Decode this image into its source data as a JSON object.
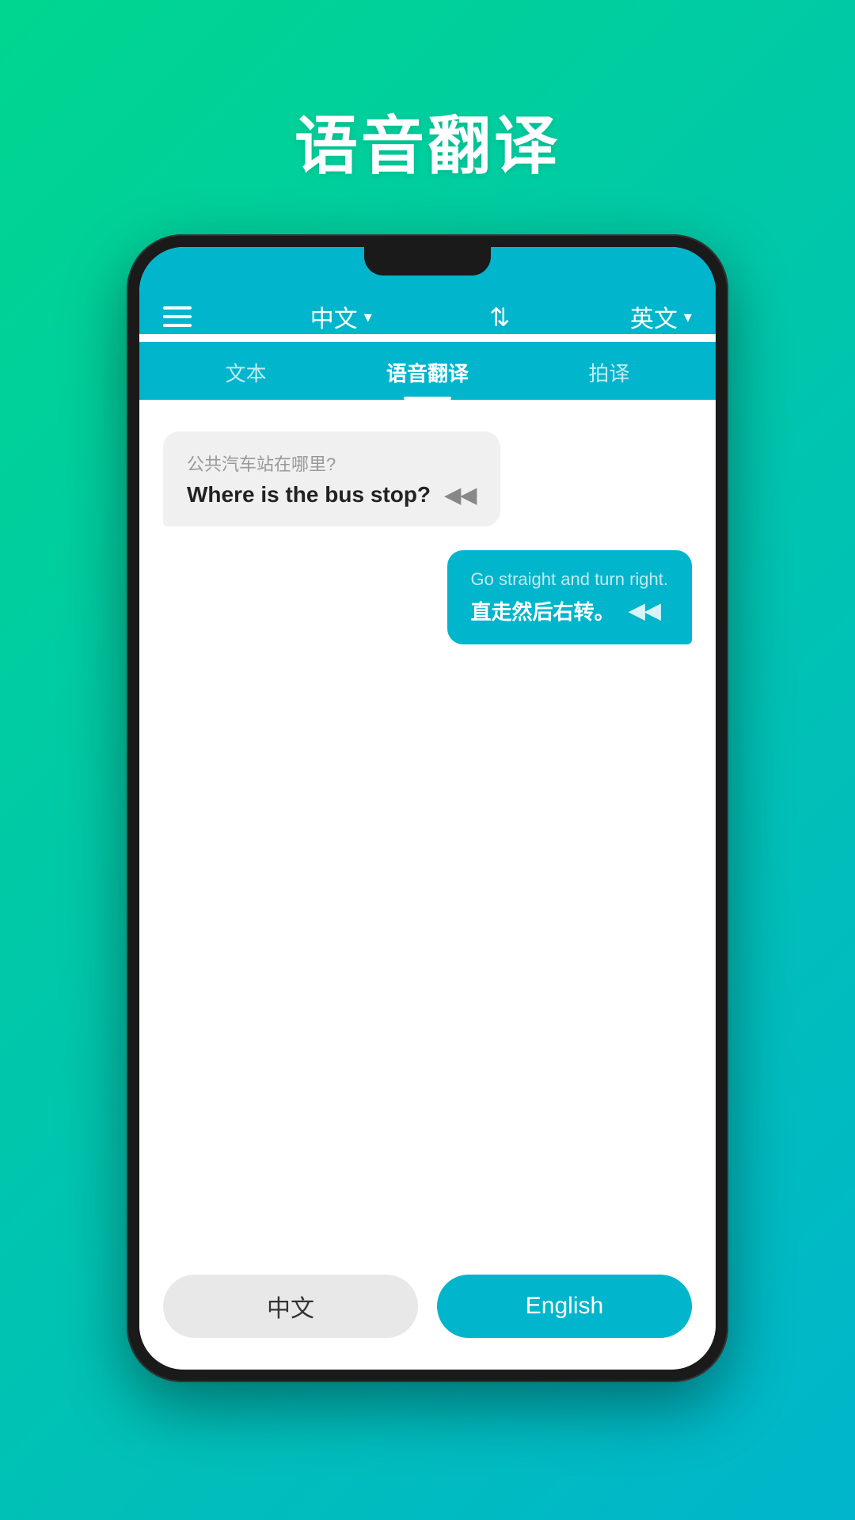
{
  "page": {
    "title": "语音翻译",
    "background_gradient_start": "#00d68f",
    "background_gradient_end": "#00b5cc"
  },
  "header": {
    "menu_icon_label": "menu",
    "source_lang": "中文",
    "source_lang_dropdown": "▾",
    "swap_icon": "⇄",
    "target_lang": "英文",
    "target_lang_dropdown": "▾"
  },
  "tabs": [
    {
      "id": "text",
      "label": "文本",
      "active": false
    },
    {
      "id": "voice",
      "label": "语音翻译",
      "active": true
    },
    {
      "id": "photo",
      "label": "拍译",
      "active": false
    }
  ],
  "messages": [
    {
      "id": 1,
      "side": "left",
      "original": "公共汽车站在哪里?",
      "translation": "Where is the bus stop?",
      "sound_symbol": "◀◀"
    },
    {
      "id": 2,
      "side": "right",
      "original": "Go straight and turn right.",
      "translation": "直走然后右转。",
      "sound_symbol": "◀◀"
    }
  ],
  "bottom_buttons": {
    "chinese_label": "中文",
    "english_label": "English"
  }
}
